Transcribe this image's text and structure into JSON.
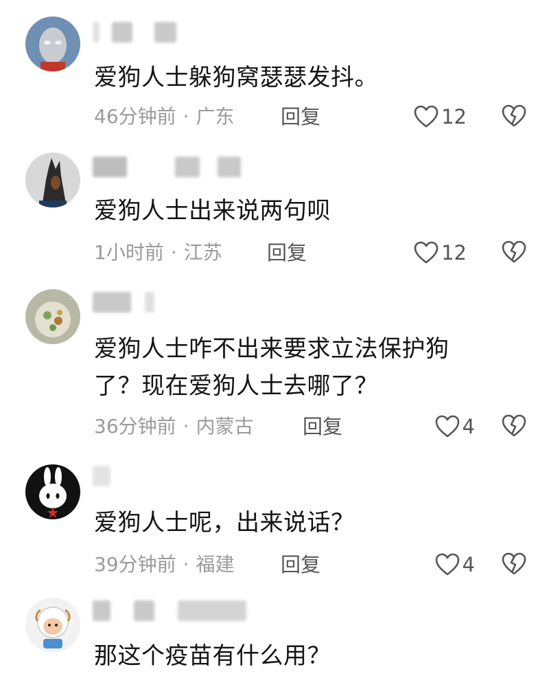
{
  "comments": [
    {
      "text": "爱狗人士躲狗窝瑟瑟发抖。",
      "time": "46分钟前",
      "location": "广东",
      "reply_label": "回复",
      "likes": "12"
    },
    {
      "text": "爱狗人士出来说两句呗",
      "time": "1小时前",
      "location": "江苏",
      "reply_label": "回复",
      "likes": "12"
    },
    {
      "text": "爱狗人士咋不出来要求立法保护狗\n了？现在爱狗人士去哪了？",
      "time": "36分钟前",
      "location": "内蒙古",
      "reply_label": "回复",
      "likes": "4"
    },
    {
      "text": "爱狗人士呢，出来说话？",
      "time": "39分钟前",
      "location": "福建",
      "reply_label": "回复",
      "likes": "4"
    },
    {
      "text": "那这个疫苗有什么用？"
    }
  ],
  "separator": "·",
  "colors": {
    "text": "#141414",
    "meta": "#9a9a9a",
    "icon": "#555555"
  }
}
